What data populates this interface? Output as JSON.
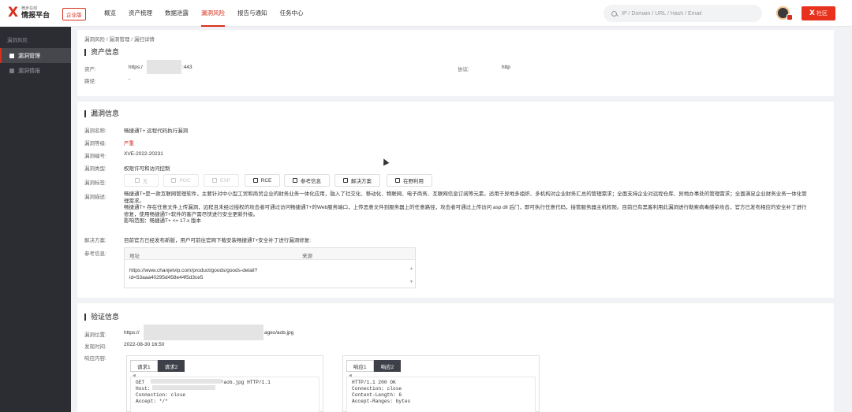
{
  "header": {
    "logo_sub": "微步在线",
    "logo_main": "情报平台",
    "edition": "企业版",
    "nav": [
      "概览",
      "资产梳理",
      "数据泄露",
      "漏洞风险",
      "报告与通知",
      "任务中心"
    ],
    "active_nav": "漏洞风险",
    "search_placeholder": "IP / Domain / URL / Hash / Email",
    "community_label": "社区",
    "accent": "#d9301e"
  },
  "sidebar": {
    "title": "漏洞风险",
    "items": [
      {
        "label": "漏洞管理",
        "icon": "lock-icon",
        "active": true
      },
      {
        "label": "漏洞情报",
        "icon": "document-icon",
        "active": false
      }
    ]
  },
  "breadcrumb": "漏洞风险 / 漏洞管理 / 漏扫详情",
  "asset": {
    "title": "资产信息",
    "asset_label": "资产:",
    "asset_prefix": "https:/",
    "asset_suffix": ":443",
    "path_label": "路径:",
    "path_value": "-",
    "protocol_label": "协议:",
    "protocol_value": "http"
  },
  "vuln": {
    "title": "漏洞信息",
    "name_label": "漏洞名称:",
    "name": "畅捷通T+ 远程代码执行漏洞",
    "level_label": "漏洞等级:",
    "level": "严重",
    "id_label": "漏洞编号:",
    "id": "XVE-2022-20231",
    "type_label": "漏洞类型:",
    "type": "权限许可和访问控制",
    "tags_label": "漏洞标签:",
    "tags": [
      {
        "label": "无",
        "icon": "user-icon",
        "enabled": false
      },
      {
        "label": "POC",
        "icon": "code-icon",
        "enabled": false
      },
      {
        "label": "EXP",
        "icon": "code-icon",
        "enabled": false
      },
      {
        "label": "RCE",
        "icon": "terminal-icon",
        "enabled": true
      },
      {
        "label": "参考信息",
        "icon": "book-icon",
        "enabled": true
      },
      {
        "label": "解决方案",
        "icon": "document-icon",
        "enabled": true
      },
      {
        "label": "在野利用",
        "icon": "grid-icon",
        "enabled": true
      }
    ],
    "desc_label": "漏洞描述:",
    "desc": [
      "畅捷通T+是一款互联网管理软件，主要针对中小型工贸和商贸企业的财务业务一体化应用，融入了社交化、移动化、物联网、电子商务、互联网信息订阅等元素。适用于异地多组织、多机构对企业财务汇总的管理需求；全面支持企业对远程仓库、异地办事处的管理需求；全面满足企业财务业务一体化管理需求。",
      "畅捷通T+ 存在任意文件上传漏洞，远程且未经过授权的攻击者可通过访问畅捷通T+的Web服务端口，上传恶意文件到服务器上的任意路径，攻击者可通过上传访问 asp dll 后门，即可执行任意代码，接管服务器主机权限。目前已有黑客利用此漏洞进行勒索病毒感染攻击，官方已发布相应的安全补丁进行修复，使用畅捷通T+软件的客户需尽快进行安全更新升级。",
      "影响范围：畅捷通T+ &lt;= 17.x 版本"
    ],
    "solution_label": "解决方案:",
    "solution": "目前官方已经发布新版，用户可前往官网下载安装畅捷通T+安全补丁进行漏洞修复:",
    "ref_label": "参考信息:",
    "ref_columns": [
      "地址",
      "来源"
    ],
    "ref_url_lines": [
      "https://www.chanjetvip.com/product/goods/goods-detail?",
      "id=53aaa40295d458e44f5d3ce5"
    ]
  },
  "verify": {
    "title": "验证信息",
    "location_label": "漏洞位置:",
    "location_prefix": "https://",
    "location_suffix": "ages/aob.jpg",
    "time_label": "发现时间:",
    "time": "2022-08-30 16:50",
    "response_label": "响应内容:",
    "request_tabs": [
      "请求1",
      "请求2"
    ],
    "request_active": 1,
    "request_lines": [
      "GET                          /aob.jpg HTTP/1.1",
      "Host:                     3",
      "Connection: close",
      "Accept: */*"
    ],
    "response_tabs": [
      "响应1",
      "响应2"
    ],
    "response_active": 1,
    "response_lines": [
      "HTTP/1.1 200 OK",
      "Connection: close",
      "Content-Length: 6",
      "Accept-Ranges: bytes"
    ]
  }
}
